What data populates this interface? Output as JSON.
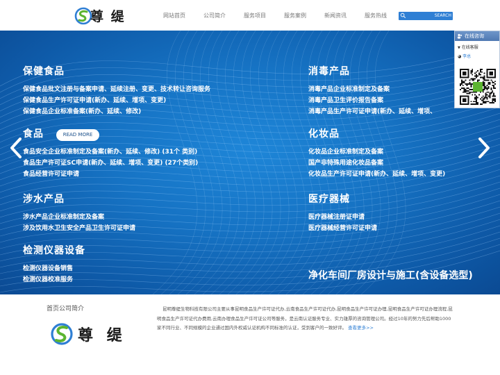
{
  "header": {
    "logo_text": "尊 缇",
    "nav": [
      "网站首页",
      "公司简介",
      "服务项目",
      "服务案例",
      "新闻资讯",
      "服务热线"
    ],
    "search": {
      "placeholder": "",
      "button": "SEARCH"
    }
  },
  "banner": {
    "categories": [
      {
        "title": "保健食品",
        "lines": [
          "保健食品批文注册与备案申请、延续注册、变更、技术转让咨询服务",
          "保健食品生产许可证申请(新办、延续、增项、变更)",
          "保健食品企业标准备案(新办、延续、修改)"
        ]
      },
      {
        "title": "食品",
        "lines": [
          "食品安全企业标准制定及备案(新办、延续、修改) (31个 类别)",
          "食品生产许可证SC申请(新办、延续、增项、变更) (27个类别)",
          "食品经营许可证申请"
        ]
      },
      {
        "title": "涉水产品",
        "lines": [
          "涉水产品企业标准制定及备案",
          "涉及饮用水卫生安全产品卫生许可证申请"
        ]
      },
      {
        "title": "检测仪器设备",
        "lines": [
          "检测仪器设备销售",
          "检测仪器校准服务"
        ]
      },
      {
        "title": "消毒产品",
        "lines": [
          "消毒产品企业标准制定及备案",
          "消毒产品卫生评价报告备案",
          "消毒产品生产许可证申请(新办、延续、增项、"
        ]
      },
      {
        "title": "化妆品",
        "lines": [
          "化妆品企业标准制定及备案",
          "国产非特殊用途化妆品备案",
          "化妆品生产许可证申请(新办、延续、增项、变更)"
        ]
      },
      {
        "title": "医疗器械",
        "lines": [
          "医疗器械注册证申请",
          "医疗器械经营许可证申请"
        ]
      }
    ],
    "read_more": "READ MORE",
    "big_title": "净化车间厂房设计与施工(含设备选型)"
  },
  "consult": {
    "title": "在线咨询",
    "subtitle": "在线客服",
    "contact": "李总"
  },
  "about": {
    "title": "首页公司简介",
    "logo_text": "尊 缇",
    "text": "昆明尊缇生物科技有限公司主要从事昆明食品生产许可证代办,云南食品生产许可证代办,昆明食品生产许可证办理,昆明食品生产许可证办理流程,昆明食品生产许可证代办费用,云南办理食品生产许可证公司等服务，是云南认证服务专业、实力雄厚的咨询管理公司。经过10年的努力先后帮助1000家不同行业、不同规模的企业通过国内外权威认证机构不同标准的认证，受到客户的一致好评。",
    "more": "查看更多>>"
  },
  "colors": {
    "brand_blue": "#2f7fd4",
    "banner_blue": "#1673c4",
    "logo_green": "#5cb531"
  }
}
